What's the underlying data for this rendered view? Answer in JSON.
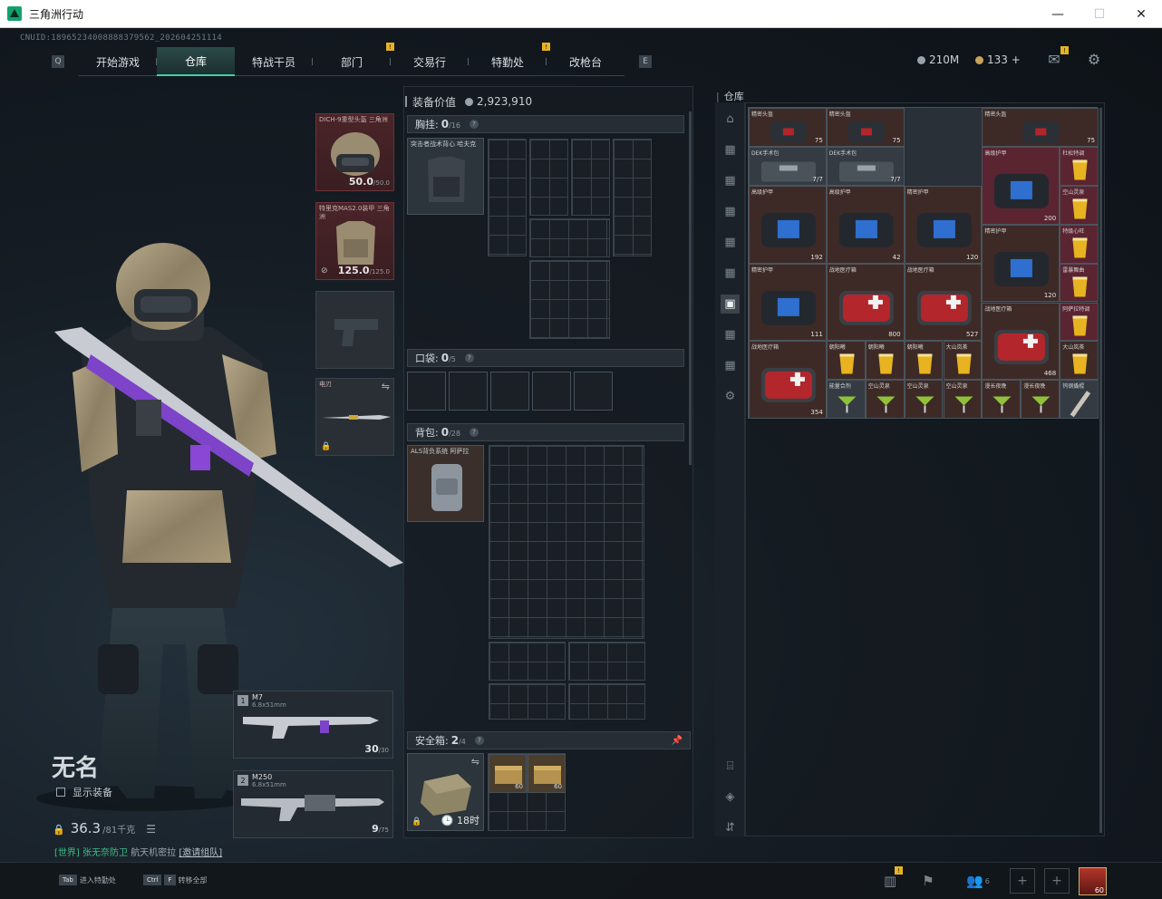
{
  "window": {
    "title": "三角洲行动",
    "min": "—",
    "max": "☐",
    "close": "✕"
  },
  "uid": "CNUID:1896523400888837956​2_202604251114",
  "nav": {
    "tabs": [
      {
        "label": "开始游戏",
        "active": false,
        "badge": ""
      },
      {
        "label": "仓库",
        "active": true,
        "badge": ""
      },
      {
        "label": "特战干员",
        "active": false,
        "badge": ""
      },
      {
        "label": "部门",
        "active": false,
        "badge": "!"
      },
      {
        "label": "交易行",
        "active": false,
        "badge": ""
      },
      {
        "label": "特勤处",
        "active": false,
        "badge": "!"
      },
      {
        "label": "改枪台",
        "active": false,
        "badge": ""
      }
    ]
  },
  "currency": {
    "hafcoin": "210M",
    "coupon": "133 +"
  },
  "icons": {
    "mail": "mail-icon",
    "settings": "gear-icon"
  },
  "character": {
    "name": "无名",
    "show_equipment": "显示装备",
    "weight_current": "36.3",
    "weight_max": "/81千克",
    "status_world": "[世界]",
    "status_player": "张无奈防卫",
    "status_map": "航天机密拉",
    "status_invite": "[邀请组队]"
  },
  "equipment": {
    "helmet": {
      "label": "DICH-9重型头盔 三角洲",
      "value": "50.0",
      "max": "/50.0"
    },
    "armor": {
      "label": "特里克MAS2.0装甲 三角洲",
      "value": "125.0",
      "max": "/125.0"
    },
    "melee": {
      "label": "电刃"
    }
  },
  "weapons": [
    {
      "slot": "1",
      "name": "M7",
      "caliber": "6.8x51mm",
      "ammo": "30",
      "ammo_max": "/30"
    },
    {
      "slot": "2",
      "name": "M250",
      "caliber": "6.8x51mm",
      "ammo": "9",
      "ammo_max": "/75"
    }
  ],
  "loadout": {
    "value_label": "装备价值",
    "value": "2,923,910",
    "chest_label": "胸挂:",
    "chest_count": "0",
    "chest_max": "/16",
    "chest_item": "突击者战术背心 哈夫克",
    "pocket_label": "口袋:",
    "pocket_count": "0",
    "pocket_max": "/5",
    "backpack_label": "背包:",
    "backpack_count": "0",
    "backpack_max": "/28",
    "backpack_item": "ALS背负系统 阿萨拉",
    "safe_label": "安全箱:",
    "safe_count": "2",
    "safe_max": "/4",
    "safe_timer": "18时",
    "safe_items": [
      {
        "count": "60"
      },
      {
        "count": "60"
      }
    ]
  },
  "warehouse": {
    "title": "仓库",
    "items": [
      {
        "name": "精密头盔",
        "count": "75"
      },
      {
        "name": "精密头盔",
        "count": "75"
      },
      {
        "name": "精密头盔",
        "count": "75"
      },
      {
        "name": "DEK手术包",
        "count": "7/7"
      },
      {
        "name": "DEK手术包",
        "count": "7/7"
      },
      {
        "name": "高级护甲",
        "count": "200"
      },
      {
        "name": "杜松特调",
        "count": ""
      },
      {
        "name": "高级护甲",
        "count": "192"
      },
      {
        "name": "高级护甲",
        "count": "42"
      },
      {
        "name": "精密护甲",
        "count": "120"
      },
      {
        "name": "精密护甲",
        "count": "120"
      },
      {
        "name": "精密护甲",
        "count": "111"
      },
      {
        "name": "战地医疗箱",
        "count": "800"
      },
      {
        "name": "战地医疗箱",
        "count": "527"
      },
      {
        "name": "战地医疗箱",
        "count": "468"
      },
      {
        "name": "战地医疗箱",
        "count": "354"
      },
      {
        "name": "空山灵泉",
        "count": ""
      },
      {
        "name": "特级心旺",
        "count": ""
      },
      {
        "name": "雷暴舞曲",
        "count": ""
      },
      {
        "name": "阿萨拉特调",
        "count": ""
      },
      {
        "name": "朝阳曦",
        "count": ""
      },
      {
        "name": "朝阳曦",
        "count": ""
      },
      {
        "name": "朝阳曦",
        "count": ""
      },
      {
        "name": "大山岚茶",
        "count": ""
      },
      {
        "name": "大山岚茶",
        "count": ""
      },
      {
        "name": "能量合剂",
        "count": ""
      },
      {
        "name": "空山灵泉",
        "count": ""
      },
      {
        "name": "空山灵泉",
        "count": ""
      },
      {
        "name": "空山灵泉",
        "count": ""
      },
      {
        "name": "漫长夜晚",
        "count": ""
      },
      {
        "name": "漫长夜晚",
        "count": ""
      },
      {
        "name": "钨钢撬棍",
        "count": ""
      }
    ]
  },
  "bottom": {
    "hint1_key": "Tab",
    "hint1_text": "进入特勤处",
    "hint2_key1": "Ctrl",
    "hint2_key2": "F",
    "hint2_text": "转移全部",
    "squad_count": "6",
    "avatar_level": "60"
  },
  "colors": {
    "accent": "#3fd1a8",
    "badge": "#e8b321",
    "red_slot": "#4a2428"
  }
}
